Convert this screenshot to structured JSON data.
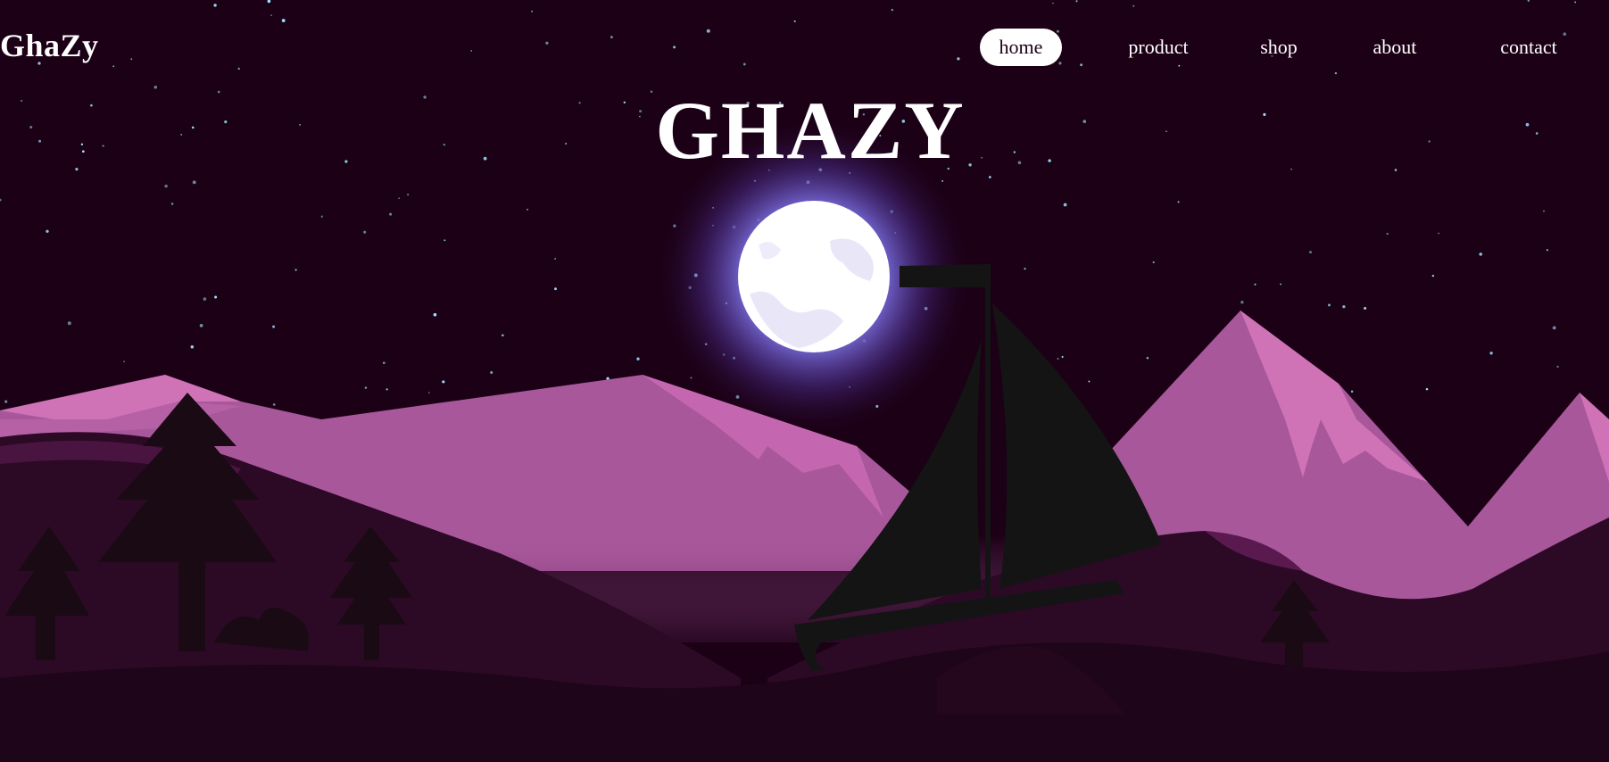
{
  "brand": {
    "logo": "GhaZy"
  },
  "nav": {
    "items": [
      {
        "label": "home",
        "active": true
      },
      {
        "label": "product",
        "active": false
      },
      {
        "label": "shop",
        "active": false
      },
      {
        "label": "about",
        "active": false
      },
      {
        "label": "contact",
        "active": false
      }
    ]
  },
  "hero": {
    "title": "GHAZY"
  },
  "illustration": {
    "icons": [
      "moon-icon",
      "sailboat-icon",
      "pine-tree-icon",
      "mountain-icon",
      "star-icon"
    ],
    "colors": {
      "sky": "#1c0016",
      "mountain": "#a8579b",
      "mountain_highlight": "#d072b6",
      "hill_dark": "#2c0a26",
      "moon": "#ffffff",
      "moon_glow": "#7a6ee0",
      "sail": "#141414"
    }
  }
}
